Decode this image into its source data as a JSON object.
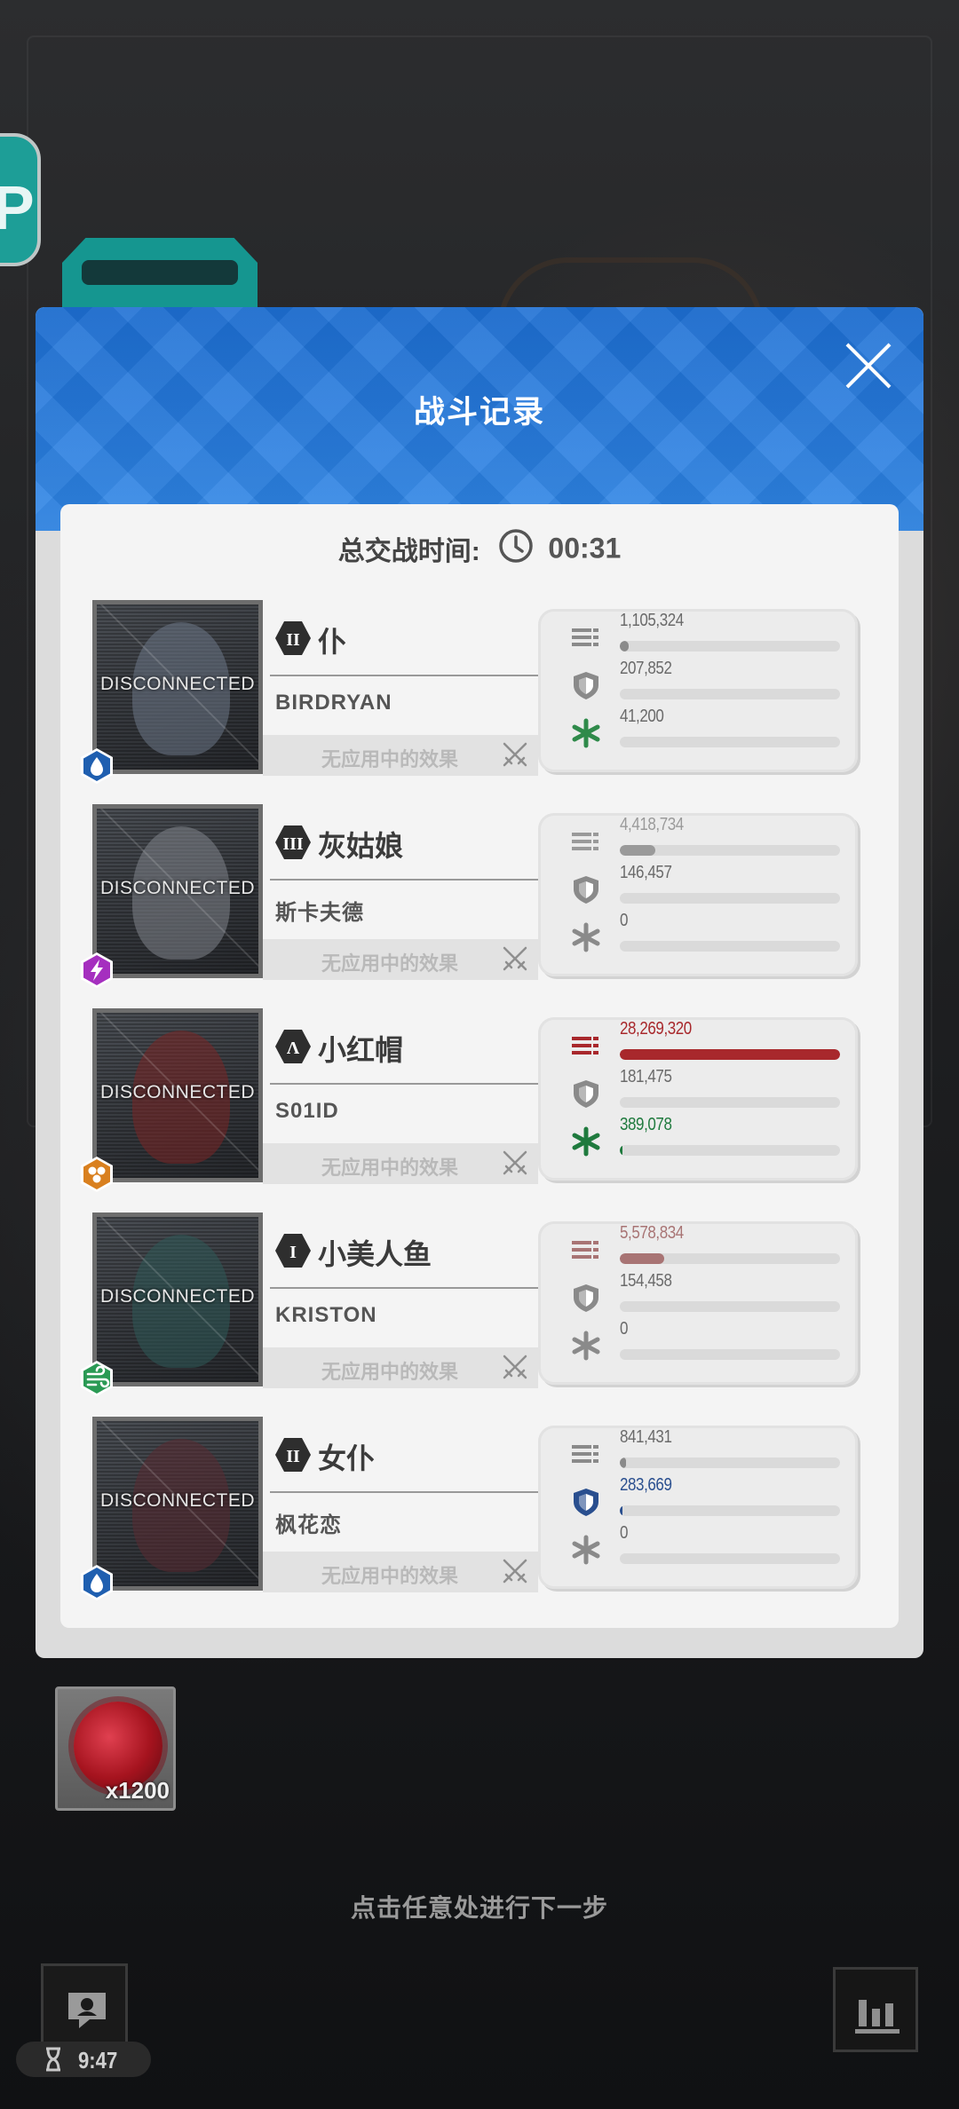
{
  "dialog": {
    "title": "战斗记录",
    "duration_label": "总交战时间:",
    "duration_value": "00:31"
  },
  "rows": [
    {
      "rank": "II",
      "character": "仆",
      "player": "BIRDRYAN",
      "status": "DISCONNECTED",
      "effects": "无应用中的效果",
      "element": "water-icon",
      "element_color": "#1f5fb0",
      "damage": "1,105,324",
      "damage_pct": 0.04,
      "damage_color": "#8a8a8a",
      "defense": "207,852",
      "defense_pct": 0.0,
      "defense_color": "#8a8a8a",
      "heal": "41,200",
      "heal_pct": 0.0,
      "heal_color": "#2f8a4a"
    },
    {
      "rank": "III",
      "character": "灰姑娘",
      "player": "斯卡夫德",
      "status": "DISCONNECTED",
      "effects": "无应用中的效果",
      "element": "electric-icon",
      "element_color": "#a52fbf",
      "damage": "4,418,734",
      "damage_pct": 0.16,
      "damage_color": "#9a9a9a",
      "defense": "146,457",
      "defense_pct": 0.0,
      "defense_color": "#8a8a8a",
      "heal": "0",
      "heal_pct": 0.0,
      "heal_color": "#8a8a8a"
    },
    {
      "rank": "Λ",
      "character": "小红帽",
      "player": "S01ID",
      "status": "DISCONNECTED",
      "effects": "无应用中的效果",
      "element": "iron-icon",
      "element_color": "#d9801f",
      "damage": "28,269,320",
      "damage_pct": 1.0,
      "damage_color": "#a8282c",
      "defense": "181,475",
      "defense_pct": 0.0,
      "defense_color": "#8a8a8a",
      "heal": "389,078",
      "heal_pct": 0.01,
      "heal_color": "#1f7a3e"
    },
    {
      "rank": "I",
      "character": "小美人鱼",
      "player": "KRISTON",
      "status": "DISCONNECTED",
      "effects": "无应用中的效果",
      "element": "wind-icon",
      "element_color": "#2a9a54",
      "damage": "5,578,834",
      "damage_pct": 0.2,
      "damage_color": "#a87474",
      "defense": "154,458",
      "defense_pct": 0.0,
      "defense_color": "#8a8a8a",
      "heal": "0",
      "heal_pct": 0.0,
      "heal_color": "#8a8a8a"
    },
    {
      "rank": "II",
      "character": "女仆",
      "player": "枫花恋",
      "status": "DISCONNECTED",
      "effects": "无应用中的效果",
      "element": "water-icon",
      "element_color": "#1f5fb0",
      "damage": "841,431",
      "damage_pct": 0.03,
      "damage_color": "#8a8a8a",
      "defense": "283,669",
      "defense_pct": 0.01,
      "defense_color": "#2a4f8f",
      "heal": "0",
      "heal_pct": 0.0,
      "heal_color": "#8a8a8a"
    }
  ],
  "reward": {
    "quantity": "x1200"
  },
  "hint": "点击任意处进行下一步",
  "timer": {
    "value": "9:47"
  }
}
